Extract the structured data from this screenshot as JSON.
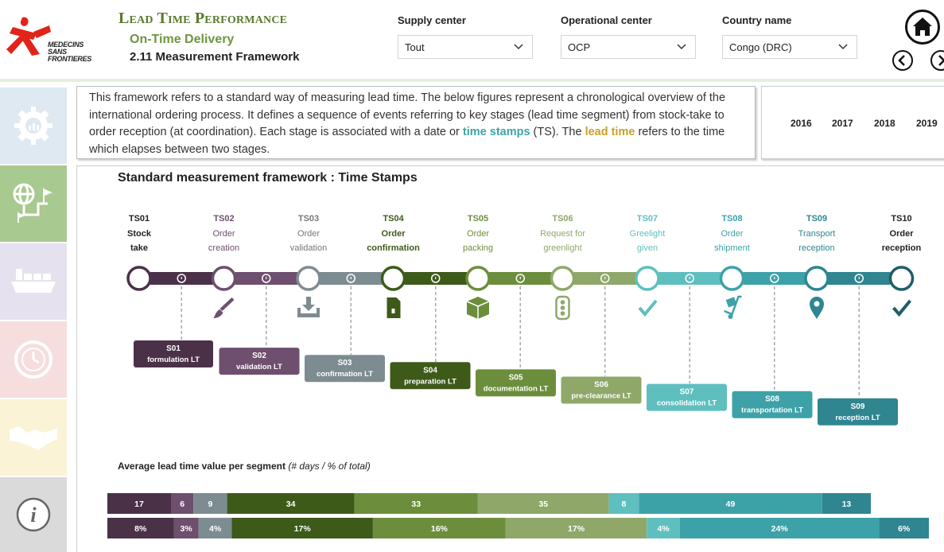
{
  "header": {
    "logo_text": "MEDECINS SANS FRONTIERES",
    "app_title": "Lead Time Performance",
    "subtitle": "On-Time Delivery",
    "page_name": "2.11 Measurement Framework"
  },
  "filters": [
    {
      "label": "Supply center",
      "value": "Tout"
    },
    {
      "label": "Operational center",
      "value": "OCP"
    },
    {
      "label": "Country name",
      "value": "Congo (DRC)"
    }
  ],
  "nav": {
    "home_icon": "home-icon",
    "prev_icon": "chevron-left-icon",
    "next_icon": "chevron-right-icon"
  },
  "sidebar": [
    {
      "name": "sidebar-gear-chart",
      "icon": "gear-chart-icon",
      "color": "#dfe9f1"
    },
    {
      "name": "sidebar-globe-route",
      "icon": "globe-route-icon",
      "color": "#a8c98f"
    },
    {
      "name": "sidebar-cargo-ship",
      "icon": "cargo-ship-icon",
      "color": "#e6e1ee"
    },
    {
      "name": "sidebar-timer",
      "icon": "timer-icon",
      "color": "#f6dede"
    },
    {
      "name": "sidebar-handshake",
      "icon": "handshake-icon",
      "color": "#faf3d6"
    },
    {
      "name": "sidebar-info",
      "icon": "info-icon",
      "color": "#dadada"
    }
  ],
  "description": {
    "p1": "This framework refers to a standard way of measuring lead time. The below figures represent a chronological overview of the international ordering process. It defines a sequence of events referring to key stages (lead time segment) from stock-take to order reception (at coordination). Each stage is associated with a date or ",
    "ts_text": "time stamps",
    "p2": " (TS). The ",
    "lt_text": "lead time",
    "p3": " refers to the time which elapses between two stages."
  },
  "years": [
    "2016",
    "2017",
    "2018",
    "2019"
  ],
  "main_title": "Standard measurement framework : Time Stamps",
  "timestamps": [
    {
      "code": "TS01",
      "l1": "Stock",
      "l2": "take",
      "color": "#4a3148",
      "icon": "none"
    },
    {
      "code": "TS02",
      "l1": "Order",
      "l2": "creation",
      "color": "#6e4f6e",
      "icon": "brush-icon"
    },
    {
      "code": "TS03",
      "l1": "Order",
      "l2": "validation",
      "color": "#7d8c91",
      "icon": "download-tray-icon"
    },
    {
      "code": "TS04",
      "l1": "Order",
      "l2": "confirmation",
      "color": "#3d5a19",
      "icon": "document-icon"
    },
    {
      "code": "TS05",
      "l1": "Order",
      "l2": "packing",
      "color": "#6c8e3c",
      "icon": "package-icon"
    },
    {
      "code": "TS06",
      "l1": "Request for",
      "l2": "greenlight",
      "color": "#8fa86a",
      "icon": "traffic-light-icon"
    },
    {
      "code": "TS07",
      "l1": "Greelight",
      "l2": "given",
      "color": "#5fbfbf",
      "icon": "checkmark-icon"
    },
    {
      "code": "TS08",
      "l1": "Order",
      "l2": "shipment",
      "color": "#3da2a8",
      "icon": "hand-truck-icon"
    },
    {
      "code": "TS09",
      "l1": "Transport",
      "l2": "reception",
      "color": "#2f8590",
      "icon": "map-pin-icon"
    },
    {
      "code": "TS10",
      "l1": "Order",
      "l2": "reception",
      "color": "#1f5e66",
      "icon": "checkmark-icon"
    }
  ],
  "segments": [
    {
      "code": "S01",
      "label": "formulation LT",
      "color": "#4a3148"
    },
    {
      "code": "S02",
      "label": "validation LT",
      "color": "#6e4f6e"
    },
    {
      "code": "S03",
      "label": "confirmation LT",
      "color": "#7d8c91"
    },
    {
      "code": "S04",
      "label": "preparation LT",
      "color": "#3d5a19"
    },
    {
      "code": "S05",
      "label": "documentation LT",
      "color": "#6c8e3c"
    },
    {
      "code": "S06",
      "label": "pre-clearance LT",
      "color": "#8fa86a"
    },
    {
      "code": "S07",
      "label": "consolidation LT",
      "color": "#5fbfbf"
    },
    {
      "code": "S08",
      "label": "transportation LT",
      "color": "#3da2a8"
    },
    {
      "code": "S09",
      "label": "reception LT",
      "color": "#2f8590"
    }
  ],
  "avg_title": {
    "main": "Average lead time value per segment ",
    "unit": "(# days / % of total)"
  },
  "chart_data": {
    "type": "bar",
    "orientation": "horizontal-stacked",
    "categories": [
      "S01",
      "S02",
      "S03",
      "S04",
      "S05",
      "S06",
      "S07",
      "S08",
      "S09"
    ],
    "series": [
      {
        "values": [
          17,
          6,
          9,
          34,
          33,
          35,
          8,
          49,
          13
        ],
        "labels": [
          "17",
          "6",
          "9",
          "34",
          "33",
          "35",
          "8",
          "49",
          "13"
        ]
      },
      {
        "values": [
          8,
          3,
          4,
          17,
          16,
          17,
          4,
          24,
          6
        ],
        "labels": [
          "8%",
          "3%",
          "4%",
          "17%",
          "16%",
          "17%",
          "4%",
          "24%",
          "6%"
        ]
      }
    ],
    "colors": [
      "#4a3148",
      "#6e4f6e",
      "#7d8c91",
      "#3d5a19",
      "#6c8e3c",
      "#8fa86a",
      "#5fbfbf",
      "#3da2a8",
      "#2f8590"
    ]
  }
}
